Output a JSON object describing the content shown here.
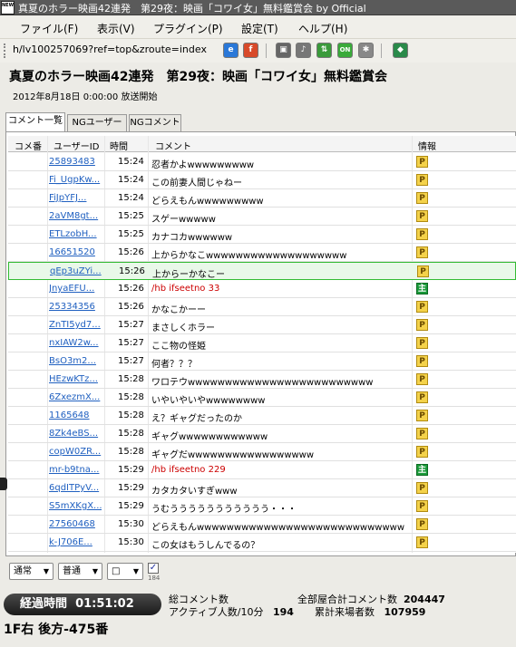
{
  "window": {
    "app_icon_text": "NEW",
    "title": "真夏のホラー映画42連発　第29夜：映画「コワイ女」無料鑑賞会 by Official"
  },
  "menu": [
    "ファイル(F)",
    "表示(V)",
    "プラグイン(P)",
    "設定(T)",
    "ヘルプ(H)"
  ],
  "address": {
    "url": "h/lv100257069?ref=top&zroute=index",
    "icons": [
      {
        "name": "ie-icon",
        "color": "#2a78d8"
      },
      {
        "name": "firefox-icon",
        "color": "#d84a2a"
      },
      {
        "name": "camera-icon",
        "color": "#666666"
      },
      {
        "name": "speaker-icon",
        "color": "#777777"
      },
      {
        "name": "network-icon",
        "color": "#3a9a3a"
      },
      {
        "name": "on-icon",
        "color": "#3aaa3a"
      },
      {
        "name": "settings-icon",
        "color": "#888888"
      },
      {
        "name": "plugin-icon",
        "color": "#2a8a4a"
      }
    ]
  },
  "program": {
    "title": "真夏のホラー映画42連発　第29夜：映画「コワイ女」無料鑑賞会",
    "start": "2012年8月18日 0:00:00 放送開始"
  },
  "tabs": [
    "コメント一覧",
    "NGユーザー",
    "NGコメント"
  ],
  "columns": {
    "number": "コメ番",
    "user_id": "ユーザーID",
    "time": "時間",
    "comment": "コメント",
    "info": "情報"
  },
  "comments": [
    {
      "uid": "25893483",
      "time": "15:24",
      "text": "忍者かよwwwwwwwww",
      "badge": "P",
      "type": "premium"
    },
    {
      "uid": "Fi_UgpKw...",
      "time": "15:24",
      "text": "この前妻人間じゃねー",
      "badge": "P",
      "type": "premium"
    },
    {
      "uid": "FiJpYFJ...",
      "time": "15:24",
      "text": "どらえもんwwwwwwwww",
      "badge": "P",
      "type": "premium"
    },
    {
      "uid": "2aVM8gt...",
      "time": "15:25",
      "text": "スゲーwwwww",
      "badge": "P",
      "type": "premium"
    },
    {
      "uid": "ETLzobH...",
      "time": "15:25",
      "text": "カナコカwwwwww",
      "badge": "P",
      "type": "premium"
    },
    {
      "uid": "16651520",
      "time": "15:26",
      "text": "上からかなこwwwwwwwwwwwwwwwwwww",
      "badge": "P",
      "type": "premium"
    },
    {
      "uid": "qEp3uZYi...",
      "time": "15:26",
      "text": "上からーかなこー",
      "badge": "P",
      "type": "premium",
      "selected": true
    },
    {
      "uid": "JnyaEFU...",
      "time": "15:26",
      "text": "/hb ifseetno 33",
      "badge": "主",
      "type": "owner"
    },
    {
      "uid": "25334356",
      "time": "15:26",
      "text": "かなこかーー",
      "badge": "P",
      "type": "premium"
    },
    {
      "uid": "ZnTI5yd7...",
      "time": "15:27",
      "text": "まさしくホラー",
      "badge": "P",
      "type": "premium"
    },
    {
      "uid": "nxIAW2w...",
      "time": "15:27",
      "text": "ここ物の怪姫",
      "badge": "P",
      "type": "premium"
    },
    {
      "uid": "BsO3m2...",
      "time": "15:27",
      "text": "何者？？？",
      "badge": "P",
      "type": "premium"
    },
    {
      "uid": "HEzwKTz...",
      "time": "15:28",
      "text": "ワロテウwwwwwwwwwwwwwwwwwwwwwwwww",
      "badge": "P",
      "type": "premium"
    },
    {
      "uid": "6ZxezmX...",
      "time": "15:28",
      "text": "いやいやいやwwwwwwww",
      "badge": "P",
      "type": "premium"
    },
    {
      "uid": "1165648",
      "time": "15:28",
      "text": "え？ギャグだったのか",
      "badge": "P",
      "type": "premium"
    },
    {
      "uid": "8Zk4eBS...",
      "time": "15:28",
      "text": "ギャグwwwwwwwwwwww",
      "badge": "P",
      "type": "premium"
    },
    {
      "uid": "copW0ZR...",
      "time": "15:28",
      "text": "ギャグだwwwwwwwwwwwwwwwww",
      "badge": "P",
      "type": "premium"
    },
    {
      "uid": "mr-b9tna...",
      "time": "15:29",
      "text": "/hb ifseetno 229",
      "badge": "主",
      "type": "owner"
    },
    {
      "uid": "6qdITPyV...",
      "time": "15:29",
      "text": "カタカタいすぎwww",
      "badge": "P",
      "type": "premium"
    },
    {
      "uid": "S5mXKgX...",
      "time": "15:29",
      "text": "うむううううううううううう・・・",
      "badge": "P",
      "type": "premium"
    },
    {
      "uid": "27560468",
      "time": "15:30",
      "text": "どらえもんwwwwwwwwwwwwwwwwwwwwwwwwwwww",
      "badge": "P",
      "type": "premium"
    },
    {
      "uid": "k-J706E...",
      "time": "15:30",
      "text": "この女はもうしんでるの？",
      "badge": "P",
      "type": "premium"
    }
  ],
  "controls": {
    "mode1": "通常",
    "mode2": "普通",
    "color": "□",
    "checkbox_mark": "✓",
    "checkbox_label": "184"
  },
  "status": {
    "elapsed_label": "経過時間",
    "elapsed": "01:51:02",
    "total_comments_label": "総コメント数",
    "total_comments": "",
    "active_label": "アクティブ人数/10分",
    "active": "194",
    "all_rooms_label": "全部屋合計コメント数",
    "all_rooms": "204447",
    "visitors_label": "累計来場者数",
    "visitors": "107959",
    "seat": "1F右 後方-475番"
  }
}
